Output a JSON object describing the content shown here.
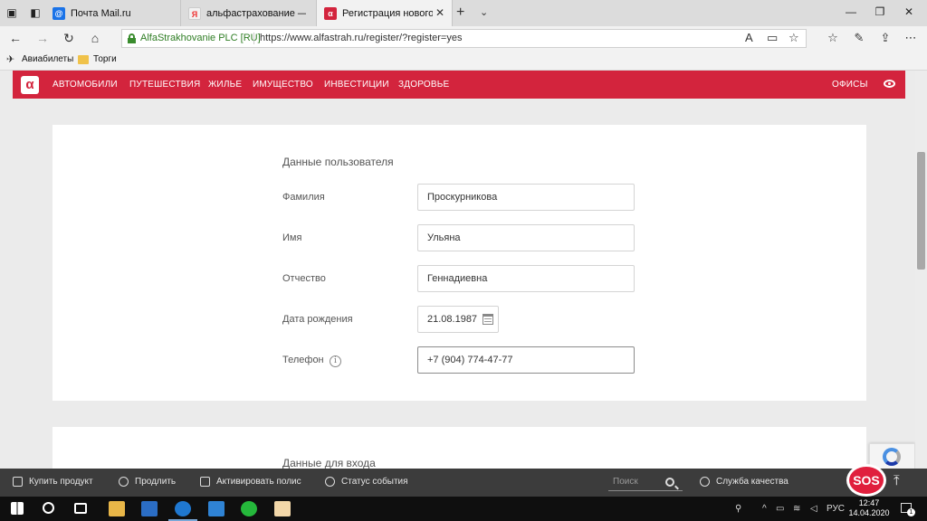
{
  "browser": {
    "tabs": [
      {
        "title": "Почта Mail.ru",
        "favicon_color": "#1a73e8",
        "active": false
      },
      {
        "title": "альфастрахование — Янде",
        "favicon_color": "#f2f2f2",
        "active": false
      },
      {
        "title": "Регистрация нового пс",
        "favicon_color": "#d3243d",
        "active": true
      }
    ],
    "new_tab_glyph": "+",
    "address": {
      "cert_label": "AlfaStrakhovanie PLC [RU]",
      "url": "https://www.alfastrah.ru/register/?register=yes"
    },
    "favorites": [
      {
        "label": "Авиабилеты",
        "icon": "plane-icon"
      },
      {
        "label": "Торги",
        "icon": "folder-icon"
      }
    ]
  },
  "site": {
    "brand_color": "#d3243d",
    "logo_glyph": "α",
    "nav": [
      {
        "label": "АВТОМОБИЛИ"
      },
      {
        "label": "ПУТЕШЕСТВИЯ"
      },
      {
        "label": "ЖИЛЬЕ"
      },
      {
        "label": "ИМУЩЕСТВО"
      },
      {
        "label": "ИНВЕСТИЦИИ"
      },
      {
        "label": "ЗДОРОВЬЕ"
      }
    ],
    "offices_label": "ОФИСЫ"
  },
  "form": {
    "section_user": "Данные пользователя",
    "fields": [
      {
        "label": "Фамилия",
        "value": "Проскурникова"
      },
      {
        "label": "Имя",
        "value": "Ульяна"
      },
      {
        "label": "Отчество",
        "value": "Геннадиевна"
      },
      {
        "label": "Дата рождения",
        "value": "21.08.1987"
      },
      {
        "label": "Телефон",
        "value": "+7 (904) 774-47-77"
      }
    ],
    "info_glyph": "i",
    "section_login": "Данные для входа"
  },
  "bottom_bar": {
    "items": [
      {
        "label": "Купить продукт"
      },
      {
        "label": "Продлить"
      },
      {
        "label": "Активировать полис"
      },
      {
        "label": "Статус события"
      }
    ],
    "search_placeholder": "Поиск",
    "quality_label": "Служба качества",
    "sos_label": "SOS"
  },
  "taskbar": {
    "language": "РУС",
    "time": "12:47",
    "date": "14.04.2020",
    "notification_count": "1"
  }
}
